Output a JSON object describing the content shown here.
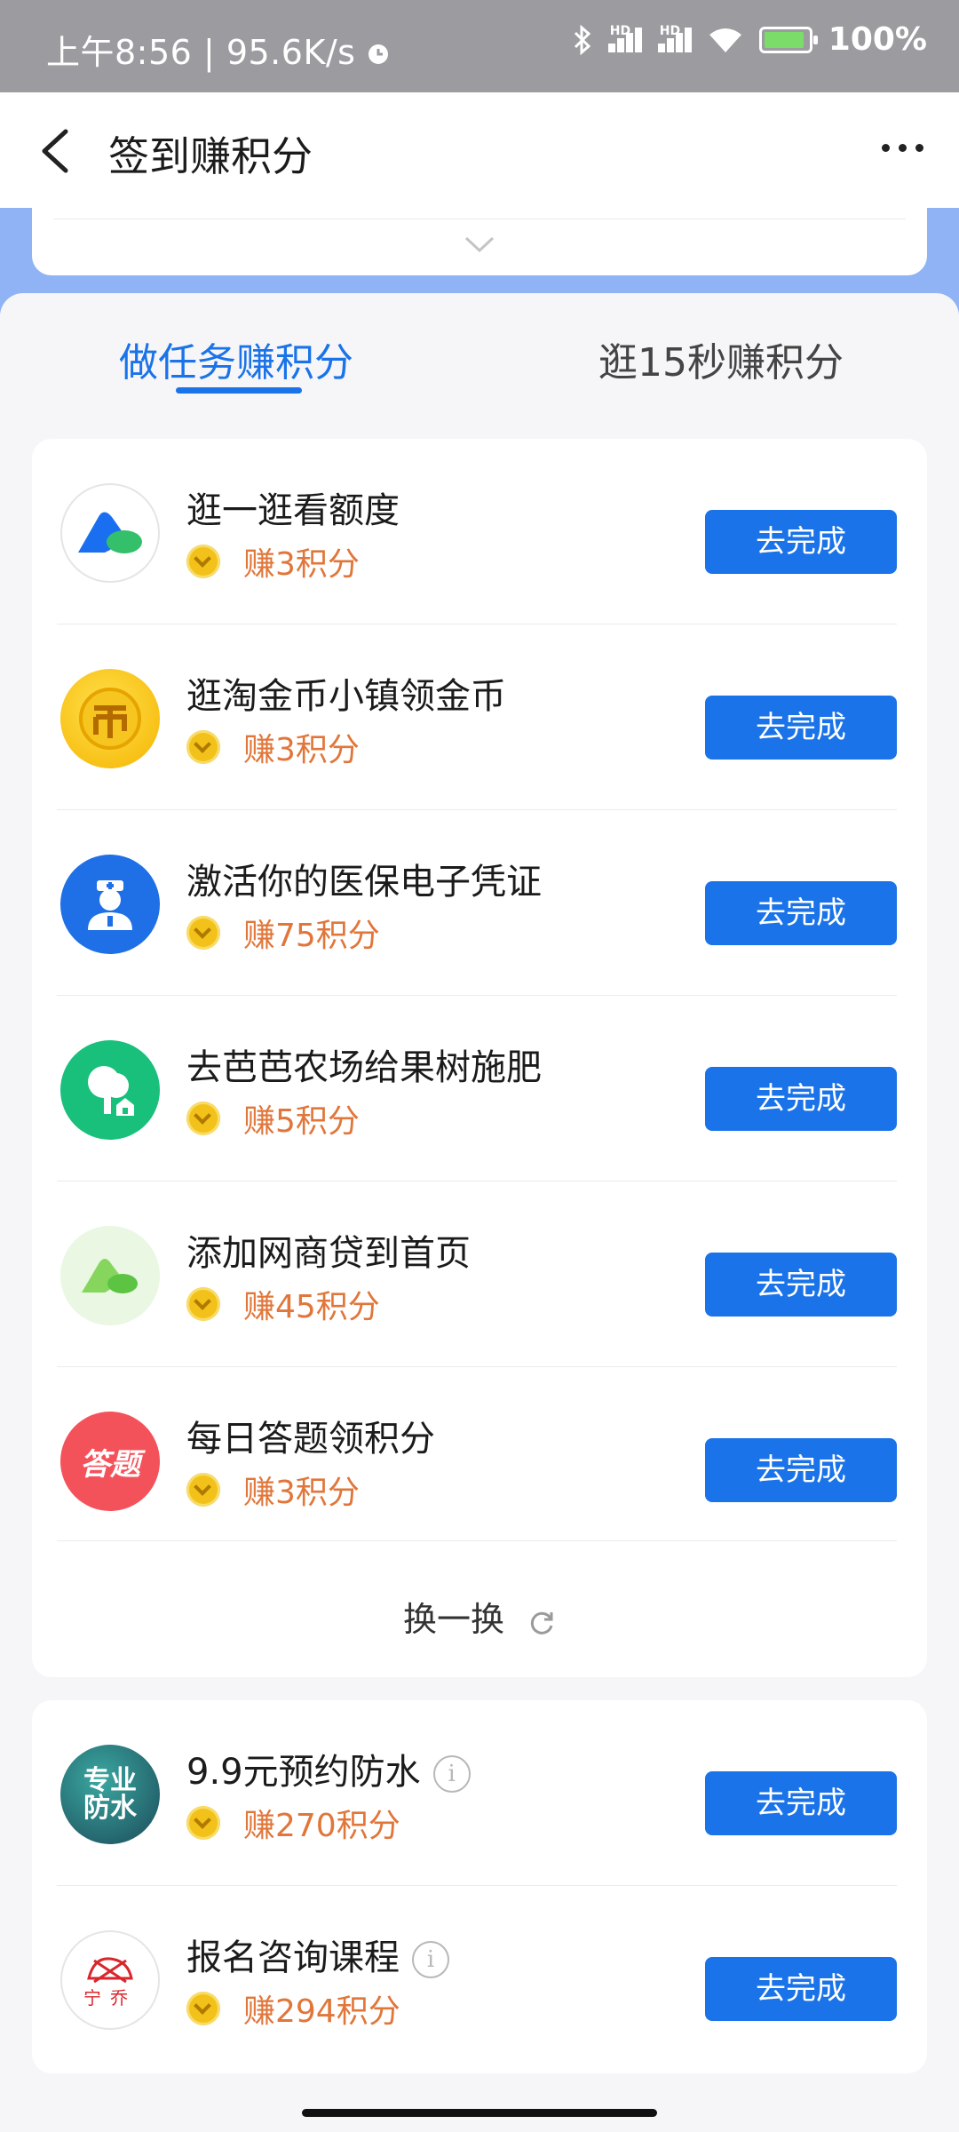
{
  "status_bar": {
    "time": "上午8:56",
    "speed": "95.6K/s",
    "battery": "100%"
  },
  "header": {
    "title": "签到赚积分"
  },
  "tabs": [
    {
      "label": "做任务赚积分"
    },
    {
      "label": "逛15秒赚积分"
    }
  ],
  "tasks": [
    {
      "title": "逛一逛看额度",
      "reward": "赚3积分",
      "button": "去完成",
      "icon": "mybank-logo-icon"
    },
    {
      "title": "逛淘金币小镇领金币",
      "reward": "赚3积分",
      "button": "去完成",
      "icon": "gold-coin-icon"
    },
    {
      "title": "激活你的医保电子凭证",
      "reward": "赚75积分",
      "button": "去完成",
      "icon": "doctor-icon"
    },
    {
      "title": "去芭芭农场给果树施肥",
      "reward": "赚5积分",
      "button": "去完成",
      "icon": "tree-icon"
    },
    {
      "title": "添加网商贷到首页",
      "reward": "赚45积分",
      "button": "去完成",
      "icon": "mybank-light-icon"
    },
    {
      "title": "每日答题领积分",
      "reward": "赚3积分",
      "button": "去完成",
      "icon": "quiz-icon",
      "icon_text": "答题"
    }
  ],
  "refresh_label": "换一换",
  "ad_tasks": [
    {
      "title": "9.9元预约防水",
      "reward": "赚270积分",
      "button": "去完成",
      "icon": "waterproof-icon",
      "icon_text": "专业防水"
    },
    {
      "title": "报名咨询课程",
      "reward": "赚294积分",
      "button": "去完成",
      "icon": "ningqiao-logo-icon",
      "icon_text": "宁乔"
    }
  ],
  "colors": {
    "accent": "#1a73e8",
    "reward": "#e1763a",
    "coin": "#f3c21a"
  }
}
